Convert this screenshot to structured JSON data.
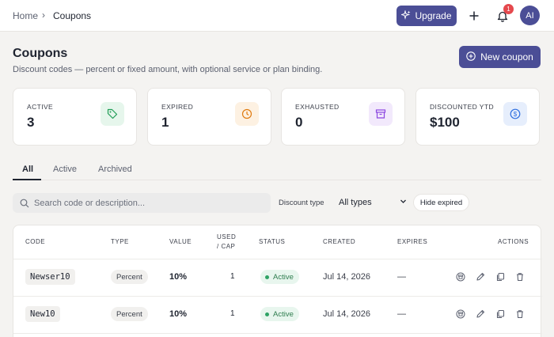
{
  "breadcrumb": {
    "home": "Home",
    "separator": "›",
    "current": "Coupons"
  },
  "topbar": {
    "upgrade_label": "Upgrade",
    "notification_count": "1",
    "avatar_initials": "AI"
  },
  "header": {
    "title": "Coupons",
    "subtitle": "Discount codes — percent or fixed amount, with optional service or plan binding.",
    "new_button_label": "New coupon"
  },
  "stats": [
    {
      "label": "Active",
      "value": "3",
      "icon": "tag-icon",
      "color": "#1f9d55"
    },
    {
      "label": "Expired",
      "value": "1",
      "icon": "clock-icon",
      "color": "#e07b10"
    },
    {
      "label": "Exhausted",
      "value": "0",
      "icon": "archive-icon",
      "color": "#8b46e0"
    },
    {
      "label": "Discounted YTD",
      "value": "$100",
      "icon": "dollar-icon",
      "color": "#2f6fe0"
    }
  ],
  "tabs": [
    {
      "label": "All"
    },
    {
      "label": "Active"
    },
    {
      "label": "Archived"
    }
  ],
  "filters": {
    "search_placeholder": "Search code or description...",
    "discount_type_label": "Discount type",
    "discount_type_value": "All types",
    "hide_expired_label": "Hide expired"
  },
  "table": {
    "columns": [
      "Code",
      "Type",
      "Value",
      "Used",
      "/ Cap",
      "Status",
      "Created",
      "Expires",
      "Actions"
    ],
    "rows": [
      {
        "code": "Newser10",
        "type": "Percent",
        "value": "10%",
        "used": "1",
        "status": "Active",
        "created": "Jul 14, 2026",
        "expires": "—"
      },
      {
        "code": "New10",
        "type": "Percent",
        "value": "10%",
        "used": "1",
        "status": "Active",
        "created": "Jul 14, 2026",
        "expires": "—"
      }
    ]
  },
  "colors": {
    "accent": "#4b4e96",
    "badge": "#e5484d",
    "status_active": "#2fa365"
  }
}
